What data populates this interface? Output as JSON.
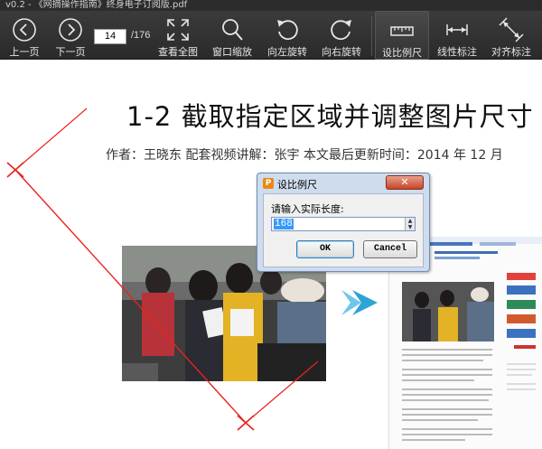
{
  "window": {
    "title": "v0.2 - 《网摘操作指南》终身电子订阅版.pdf"
  },
  "toolbar": {
    "prev_page": "上一页",
    "next_page": "下一页",
    "page_current": "14",
    "page_total": "/176",
    "view_all": "查看全图",
    "window_zoom": "窗口缩放",
    "rotate_left": "向左旋转",
    "rotate_right": "向右旋转",
    "set_scale": "设比例尺",
    "linear_mark": "线性标注",
    "align_mark": "对齐标注"
  },
  "document": {
    "title": "1-2  截取指定区域并调整图片尺寸",
    "meta": "作者：王晓东    配套视频讲解：张宇    本文最后更新时间：2014 年 12 月"
  },
  "dialog": {
    "icon_letter": "P",
    "title": "设比例尺",
    "close": "✕",
    "prompt": "请输入实际长度:",
    "value": "168",
    "ok": "OK",
    "cancel": "Cancel"
  },
  "colors": {
    "toolbar_bg": "#2a2a2a",
    "measure_line": "#e8231f",
    "dialog_frame": "#cfdced",
    "selection": "#3399ff"
  }
}
